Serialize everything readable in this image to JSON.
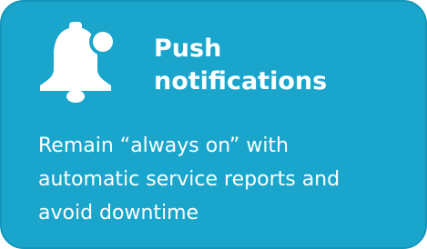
{
  "card": {
    "icon": "bell-notification-icon",
    "title_lines": [
      "Push",
      "notifications"
    ],
    "description_lines": [
      "Remain “always on” with",
      "automatic service reports and",
      "avoid downtime"
    ],
    "colors": {
      "background": "#1aa6cc",
      "text": "#ffffff"
    }
  }
}
